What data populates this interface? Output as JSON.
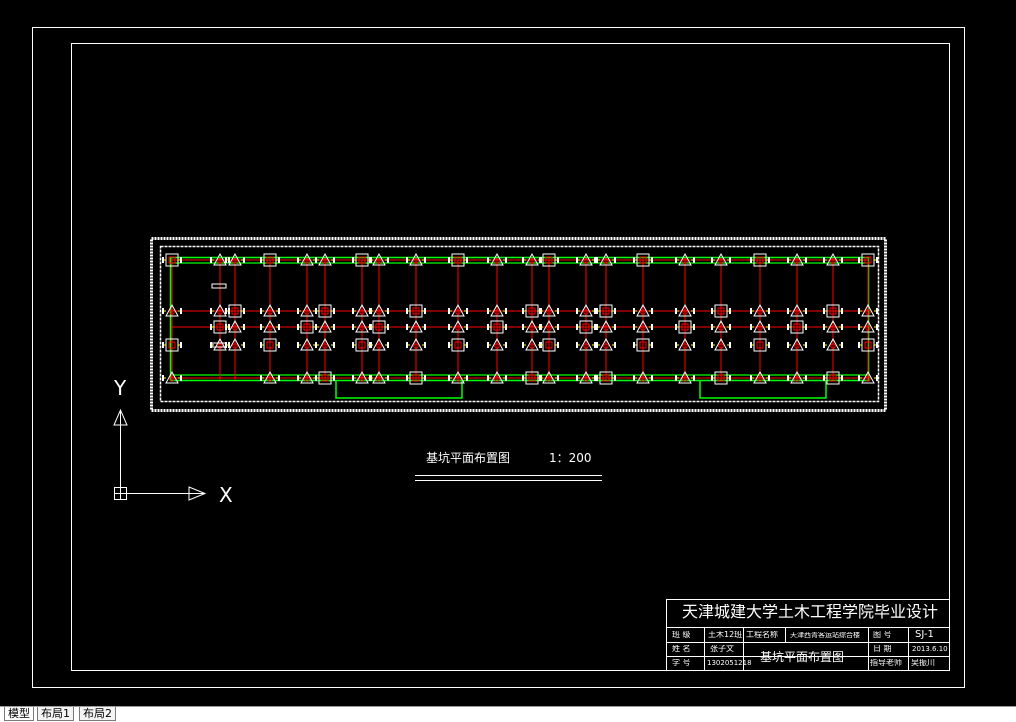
{
  "colors": {
    "background": "#000000",
    "frame": "#ffffff",
    "beam": "#ff0000",
    "grid": "#00ff00",
    "pile": "#ffff00"
  },
  "drawing": {
    "title": "基坑平面布置图",
    "scale": "1：200"
  },
  "ucs": {
    "x_label": "X",
    "y_label": "Y",
    "icon": "ucs-axis-icon"
  },
  "title_block": {
    "school": "天津城建大学土木工程学院毕业设计",
    "class_label": "班 级",
    "class_value": "土木12班",
    "project_label": "工程名称",
    "project_value": "天津西青客运站综合楼",
    "drawing_no_label": "图 号",
    "drawing_no_value": "SJ-1",
    "name_label": "姓 名",
    "name_value": "张子文",
    "drawing_name": "基坑平面布置图",
    "date_label": "日 期",
    "date_value": "2013.6.10",
    "id_label": "学 号",
    "id_value": "1302051218",
    "advisor_label": "指导老师",
    "advisor_value": "吴振川"
  },
  "tabs": [
    {
      "label": "模型",
      "active": true
    },
    {
      "label": "布局1",
      "active": false
    },
    {
      "label": "布局2",
      "active": false
    }
  ]
}
